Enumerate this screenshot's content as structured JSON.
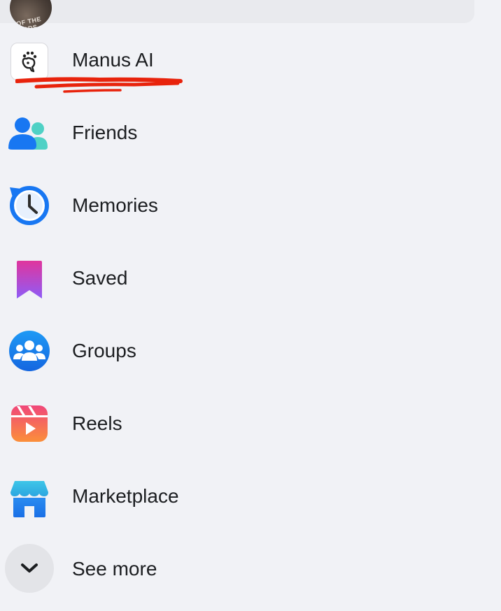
{
  "profile": {
    "avatar_text": "OF THE GODS"
  },
  "menu": {
    "items": [
      {
        "label": "Manus AI",
        "icon": "manus-hand-icon"
      },
      {
        "label": "Friends",
        "icon": "friends-icon"
      },
      {
        "label": "Memories",
        "icon": "memories-clock-icon"
      },
      {
        "label": "Saved",
        "icon": "saved-bookmark-icon"
      },
      {
        "label": "Groups",
        "icon": "groups-icon"
      },
      {
        "label": "Reels",
        "icon": "reels-icon"
      },
      {
        "label": "Marketplace",
        "icon": "marketplace-store-icon"
      },
      {
        "label": "See more",
        "icon": "chevron-down-icon"
      }
    ]
  },
  "colors": {
    "background": "#f1f2f6",
    "text": "#1c1e21",
    "facebook_blue": "#1877f2",
    "annotation_red": "#e8230c"
  }
}
